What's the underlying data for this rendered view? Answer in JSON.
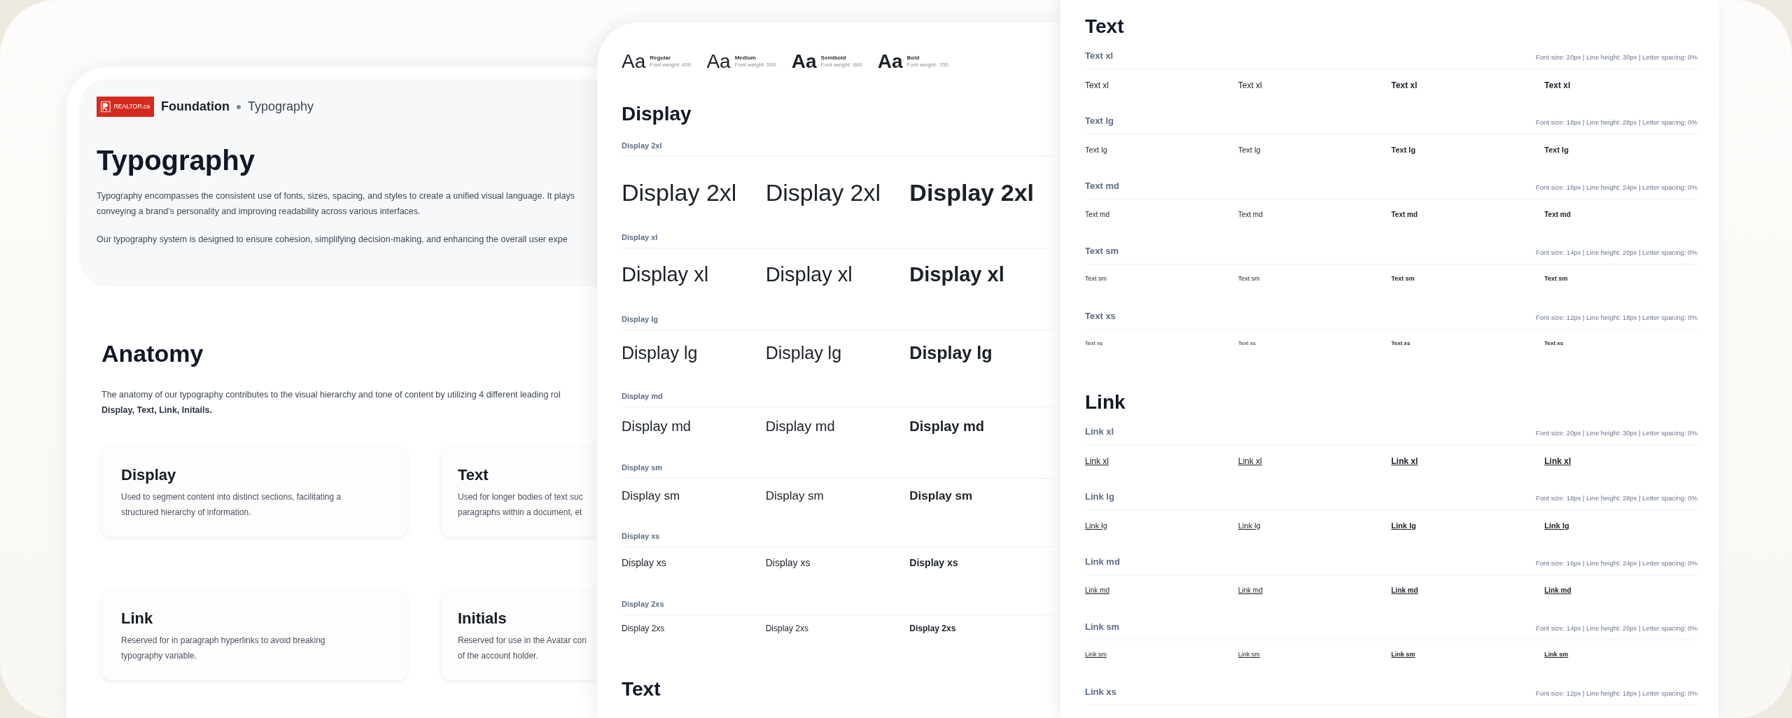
{
  "overview": {
    "logo": {
      "text": "REALTOR.ca"
    },
    "breadcrumb": [
      "Foundation",
      "Typography"
    ],
    "title": "Typography",
    "paragraphs": [
      [
        "Typography encompasses the consistent use of fonts, sizes, spacing, and styles to create a unified visual language. It plays",
        "conveying a brand’s personality and improving readability across various interfaces."
      ],
      [
        "Our typography system is designed to ensure cohesion, simplifying decision-making, and enhancing the overall user expe"
      ]
    ],
    "anatomy": {
      "title": "Anatomy",
      "lines": [
        {
          "text": "The anatomy of our typography contributes to the visual hierarchy and tone of content by utilizing 4 different leading rol",
          "bold": false
        },
        {
          "text": "Display, Text, Link, Initails.",
          "bold": true
        }
      ],
      "cards": [
        {
          "title": "Display",
          "lines": [
            "Used to segment content into distinct sections, facilitating a",
            "structured hierarchy of information."
          ]
        },
        {
          "title": "Text",
          "lines": [
            "Used for longer bodies of text suc",
            "paragraphs within a document, et"
          ]
        },
        {
          "title": "Link",
          "lines": [
            "Reserved for in paragraph hyperlinks to avoid breaking",
            "typography variable."
          ]
        },
        {
          "title": "Initials",
          "lines": [
            "Reserved for use in the Avatar con",
            "of the account holder."
          ]
        }
      ]
    }
  },
  "display_sheet": {
    "weights": [
      {
        "sample": "Aa",
        "name": "Regular",
        "detail": "Font weight: 400"
      },
      {
        "sample": "Aa",
        "name": "Medium",
        "detail": "Font weight: 500"
      },
      {
        "sample": "Aa",
        "name": "Semibold",
        "detail": "Font weight: 600"
      },
      {
        "sample": "Aa",
        "name": "Bold",
        "detail": "Font weight: 700"
      }
    ],
    "title": "Display",
    "rows": [
      {
        "label": "Display 2xl",
        "samples": [
          "Display 2xl",
          "Display 2xl",
          "Display 2xl"
        ]
      },
      {
        "label": "Display xl",
        "samples": [
          "Display xl",
          "Display xl",
          "Display xl"
        ]
      },
      {
        "label": "Display lg",
        "samples": [
          "Display lg",
          "Display lg",
          "Display lg"
        ]
      },
      {
        "label": "Display md",
        "samples": [
          "Display md",
          "Display md",
          "Display md"
        ]
      },
      {
        "label": "Display sm",
        "samples": [
          "Display sm",
          "Display sm",
          "Display sm"
        ]
      },
      {
        "label": "Display xs",
        "samples": [
          "Display xs",
          "Display xs",
          "Display xs"
        ]
      },
      {
        "label": "Display 2xs",
        "samples": [
          "Display 2xs",
          "Display 2xs",
          "Display 2xs"
        ]
      }
    ],
    "next_title": "Text"
  },
  "text_sheet": {
    "sections": [
      {
        "kind": "text",
        "title": "Text",
        "rows": [
          {
            "label": "Text xl",
            "spec": "Font size: 20px | Line height: 30px | Letter spacing: 0%",
            "samples": [
              "Text xl",
              "Text xl",
              "Text xl",
              "Text xl"
            ]
          },
          {
            "label": "Text lg",
            "spec": "Font size: 18px | Line height: 28px | Letter spacing: 0%",
            "samples": [
              "Text lg",
              "Text lg",
              "Text lg",
              "Text lg"
            ]
          },
          {
            "label": "Text md",
            "spec": "Font size: 16px | Line height: 24px | Letter spacing: 0%",
            "samples": [
              "Text md",
              "Text md",
              "Text md",
              "Text md"
            ]
          },
          {
            "label": "Text sm",
            "spec": "Font size: 14px | Line height: 20px | Letter spacing: 0%",
            "samples": [
              "Text sm",
              "Text sm",
              "Text sm",
              "Text sm"
            ]
          },
          {
            "label": "Text xs",
            "spec": "Font size: 12px | Line height: 18px | Letter spacing: 0%",
            "samples": [
              "Text xs",
              "Text xs",
              "Text xs",
              "Text xs"
            ]
          }
        ]
      },
      {
        "kind": "link",
        "title": "Link",
        "rows": [
          {
            "label": "Link xl",
            "spec": "Font size: 20px | Line height: 30px | Letter spacing: 0%",
            "samples": [
              "Link xl",
              "Link xl",
              "Link xl",
              "Link xl"
            ]
          },
          {
            "label": "Link lg",
            "spec": "Font size: 18px | Line height: 28px | Letter spacing: 0%",
            "samples": [
              "Link lg",
              "Link lg",
              "Link lg",
              "Link lg"
            ]
          },
          {
            "label": "Link md",
            "spec": "Font size: 16px | Line height: 24px | Letter spacing: 0%",
            "samples": [
              "Link md",
              "Link md",
              "Link md",
              "Link md"
            ]
          },
          {
            "label": "Link sm",
            "spec": "Font size: 14px | Line height: 20px | Letter spacing: 0%",
            "samples": [
              "Link sm",
              "Link sm",
              "Link sm",
              "Link sm"
            ]
          },
          {
            "label": "Link xs",
            "spec": "Font size: 12px | Line height: 18px | Letter spacing: 0%",
            "samples": []
          }
        ]
      }
    ]
  }
}
